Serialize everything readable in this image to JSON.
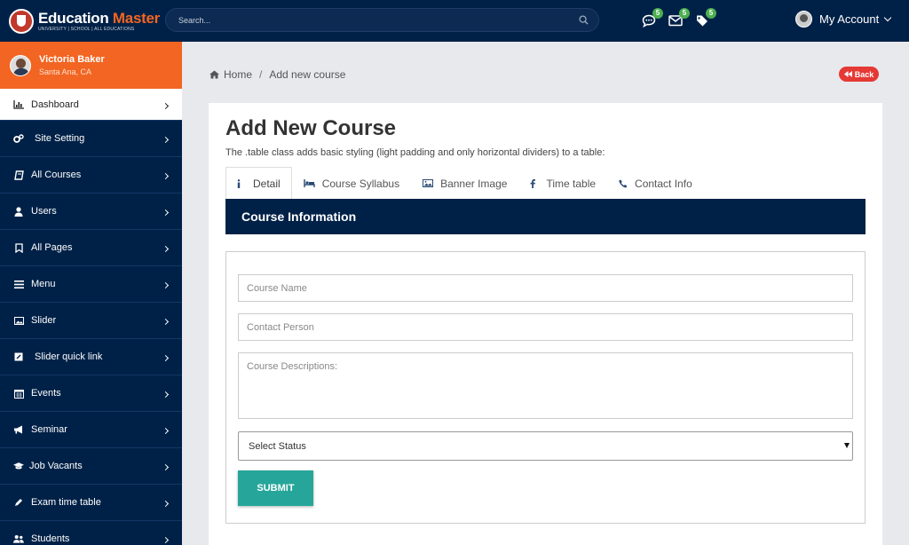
{
  "brand": {
    "title_main": "Education",
    "title_accent": "Master",
    "subtitle": "UNIVERSITY | SCHOOL | ALL EDUCATIONS",
    "accent_color": "#f26522",
    "navy": "#002147"
  },
  "search": {
    "placeholder": "Search..."
  },
  "notifications": [
    {
      "icon": "chat-icon",
      "count": "5"
    },
    {
      "icon": "envelope-icon",
      "count": "5"
    },
    {
      "icon": "tags-icon",
      "count": "5"
    }
  ],
  "account": {
    "label": "My Account"
  },
  "profile": {
    "name": "Victoria Baker",
    "location": "Santa Ana, CA"
  },
  "sidebar": {
    "items": [
      {
        "label": "Dashboard",
        "icon": "bar-chart-icon",
        "active": true
      },
      {
        "label": "Site Setting",
        "icon": "cogs-icon"
      },
      {
        "label": "All Courses",
        "icon": "book-icon"
      },
      {
        "label": "Users",
        "icon": "user-icon"
      },
      {
        "label": "All Pages",
        "icon": "bookmark-icon"
      },
      {
        "label": "Menu",
        "icon": "bars-icon"
      },
      {
        "label": "Slider",
        "icon": "image-icon"
      },
      {
        "label": "Slider quick link",
        "icon": "edit-icon"
      },
      {
        "label": "Events",
        "icon": "calendar-icon"
      },
      {
        "label": "Seminar",
        "icon": "bullhorn-icon"
      },
      {
        "label": "Job Vacants",
        "icon": "graduation-cap-icon"
      },
      {
        "label": "Exam time table",
        "icon": "pencil-icon"
      },
      {
        "label": "Students",
        "icon": "users-icon"
      }
    ]
  },
  "breadcrumb": {
    "home": "Home",
    "separator": "/",
    "current": "Add new course"
  },
  "back_button": "Back",
  "page": {
    "title": "Add New Course",
    "description": "The .table class adds basic styling (light padding and only horizontal dividers) to a table:"
  },
  "tabs": [
    {
      "label": "Detail",
      "icon": "info-icon",
      "active": true
    },
    {
      "label": "Course Syllabus",
      "icon": "bed-icon"
    },
    {
      "label": "Banner Image",
      "icon": "image-icon"
    },
    {
      "label": "Time table",
      "icon": "facebook-icon"
    },
    {
      "label": "Contact Info",
      "icon": "phone-icon"
    }
  ],
  "section": {
    "title": "Course Information"
  },
  "form": {
    "course_name_placeholder": "Course Name",
    "contact_person_placeholder": "Contact Person",
    "description_placeholder": "Course Descriptions:",
    "status_selected": "Select Status",
    "submit_label": "SUBMIT",
    "submit_color": "#26a69a"
  }
}
